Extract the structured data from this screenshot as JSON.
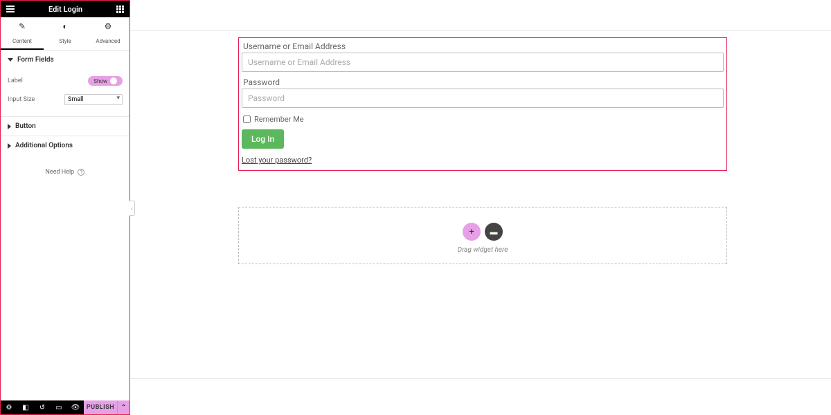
{
  "header": {
    "title": "Edit Login"
  },
  "tabs": {
    "content": {
      "label": "Content"
    },
    "style": {
      "label": "Style"
    },
    "advanced": {
      "label": "Advanced"
    }
  },
  "sections": {
    "form_fields": {
      "title": "Form Fields",
      "controls": {
        "label": {
          "name": "Label",
          "toggle_text": "Show"
        },
        "input_size": {
          "name": "Input Size",
          "value": "Small"
        }
      }
    },
    "button": {
      "title": "Button"
    },
    "additional_options": {
      "title": "Additional Options"
    }
  },
  "need_help": "Need Help",
  "bottom_bar": {
    "publish": "PUBLISH"
  },
  "login_form": {
    "username_label": "Username or Email Address",
    "username_placeholder": "Username or Email Address",
    "password_label": "Password",
    "password_placeholder": "Password",
    "remember": "Remember Me",
    "submit": "Log In",
    "lost_password": "Lost your password?"
  },
  "drop_zone": {
    "text": "Drag widget here"
  }
}
